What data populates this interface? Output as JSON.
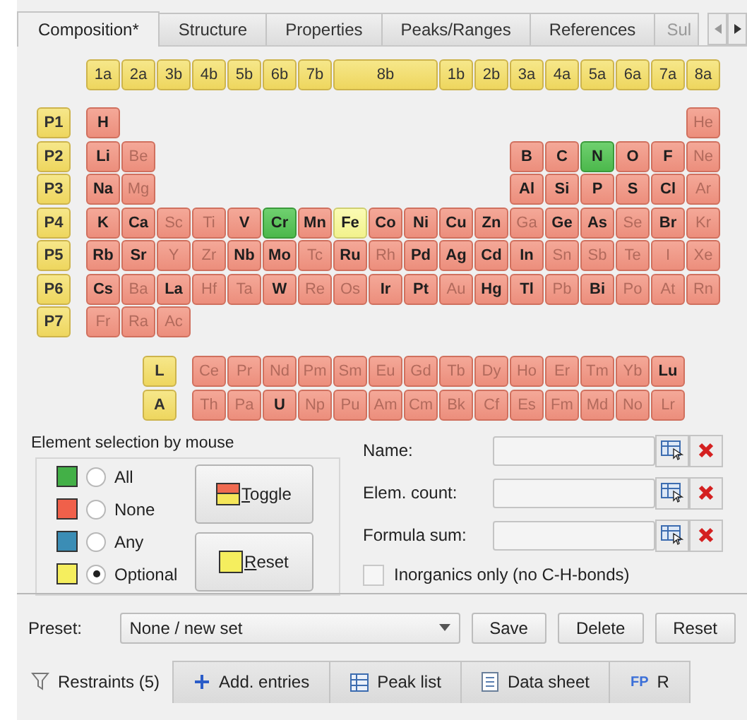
{
  "tabs": [
    {
      "label": "Composition*",
      "selected": true
    },
    {
      "label": "Structure",
      "selected": false
    },
    {
      "label": "Properties",
      "selected": false
    },
    {
      "label": "Peaks/Ranges",
      "selected": false
    },
    {
      "label": "References",
      "selected": false
    },
    {
      "label": "Sul",
      "selected": false
    }
  ],
  "groups": [
    {
      "label": "1a",
      "wide": false
    },
    {
      "label": "2a",
      "wide": false
    },
    {
      "label": "3b",
      "wide": false
    },
    {
      "label": "4b",
      "wide": false
    },
    {
      "label": "5b",
      "wide": false
    },
    {
      "label": "6b",
      "wide": false
    },
    {
      "label": "7b",
      "wide": false
    },
    {
      "label": "8b",
      "wide": true
    },
    {
      "label": "1b",
      "wide": false
    },
    {
      "label": "2b",
      "wide": false
    },
    {
      "label": "3a",
      "wide": false
    },
    {
      "label": "4a",
      "wide": false
    },
    {
      "label": "5a",
      "wide": false
    },
    {
      "label": "6a",
      "wide": false
    },
    {
      "label": "7a",
      "wide": false
    },
    {
      "label": "8a",
      "wide": false
    }
  ],
  "periods": [
    {
      "label": "P1",
      "left": [
        {
          "symbol": "H",
          "kind": "none",
          "dim": false
        }
      ],
      "right": [
        {
          "symbol": "He",
          "kind": "none",
          "dim": true
        }
      ]
    },
    {
      "label": "P2",
      "left": [
        {
          "symbol": "Li",
          "kind": "none",
          "dim": false
        },
        {
          "symbol": "Be",
          "kind": "none",
          "dim": true
        }
      ],
      "right": [
        {
          "symbol": "B",
          "kind": "none",
          "dim": false
        },
        {
          "symbol": "C",
          "kind": "none",
          "dim": false
        },
        {
          "symbol": "N",
          "kind": "all",
          "dim": false
        },
        {
          "symbol": "O",
          "kind": "none",
          "dim": false
        },
        {
          "symbol": "F",
          "kind": "none",
          "dim": false
        },
        {
          "symbol": "Ne",
          "kind": "none",
          "dim": true
        }
      ]
    },
    {
      "label": "P3",
      "left": [
        {
          "symbol": "Na",
          "kind": "none",
          "dim": false
        },
        {
          "symbol": "Mg",
          "kind": "none",
          "dim": true
        }
      ],
      "right": [
        {
          "symbol": "Al",
          "kind": "none",
          "dim": false
        },
        {
          "symbol": "Si",
          "kind": "none",
          "dim": false
        },
        {
          "symbol": "P",
          "kind": "none",
          "dim": false
        },
        {
          "symbol": "S",
          "kind": "none",
          "dim": false
        },
        {
          "symbol": "Cl",
          "kind": "none",
          "dim": false
        },
        {
          "symbol": "Ar",
          "kind": "none",
          "dim": true
        }
      ]
    },
    {
      "label": "P4",
      "left": [
        {
          "symbol": "K",
          "kind": "none",
          "dim": false
        },
        {
          "symbol": "Ca",
          "kind": "none",
          "dim": false
        },
        {
          "symbol": "Sc",
          "kind": "none",
          "dim": true
        },
        {
          "symbol": "Ti",
          "kind": "none",
          "dim": true
        },
        {
          "symbol": "V",
          "kind": "none",
          "dim": false
        },
        {
          "symbol": "Cr",
          "kind": "all",
          "dim": false
        },
        {
          "symbol": "Mn",
          "kind": "none",
          "dim": false
        },
        {
          "symbol": "Fe",
          "kind": "optional",
          "dim": false
        },
        {
          "symbol": "Co",
          "kind": "none",
          "dim": false
        },
        {
          "symbol": "Ni",
          "kind": "none",
          "dim": false
        },
        {
          "symbol": "Cu",
          "kind": "none",
          "dim": false
        },
        {
          "symbol": "Zn",
          "kind": "none",
          "dim": false
        },
        {
          "symbol": "Ga",
          "kind": "none",
          "dim": true
        },
        {
          "symbol": "Ge",
          "kind": "none",
          "dim": false
        },
        {
          "symbol": "As",
          "kind": "none",
          "dim": false
        },
        {
          "symbol": "Se",
          "kind": "none",
          "dim": true
        },
        {
          "symbol": "Br",
          "kind": "none",
          "dim": false
        },
        {
          "symbol": "Kr",
          "kind": "none",
          "dim": true
        }
      ]
    },
    {
      "label": "P5",
      "left": [
        {
          "symbol": "Rb",
          "kind": "none",
          "dim": false
        },
        {
          "symbol": "Sr",
          "kind": "none",
          "dim": false
        },
        {
          "symbol": "Y",
          "kind": "none",
          "dim": true
        },
        {
          "symbol": "Zr",
          "kind": "none",
          "dim": true
        },
        {
          "symbol": "Nb",
          "kind": "none",
          "dim": false
        },
        {
          "symbol": "Mo",
          "kind": "none",
          "dim": false
        },
        {
          "symbol": "Tc",
          "kind": "none",
          "dim": true
        },
        {
          "symbol": "Ru",
          "kind": "none",
          "dim": false
        },
        {
          "symbol": "Rh",
          "kind": "none",
          "dim": true
        },
        {
          "symbol": "Pd",
          "kind": "none",
          "dim": false
        },
        {
          "symbol": "Ag",
          "kind": "none",
          "dim": false
        },
        {
          "symbol": "Cd",
          "kind": "none",
          "dim": false
        },
        {
          "symbol": "In",
          "kind": "none",
          "dim": false
        },
        {
          "symbol": "Sn",
          "kind": "none",
          "dim": true
        },
        {
          "symbol": "Sb",
          "kind": "none",
          "dim": true
        },
        {
          "symbol": "Te",
          "kind": "none",
          "dim": true
        },
        {
          "symbol": "I",
          "kind": "none",
          "dim": true
        },
        {
          "symbol": "Xe",
          "kind": "none",
          "dim": true
        }
      ]
    },
    {
      "label": "P6",
      "left": [
        {
          "symbol": "Cs",
          "kind": "none",
          "dim": false
        },
        {
          "symbol": "Ba",
          "kind": "none",
          "dim": true
        },
        {
          "symbol": "La",
          "kind": "none",
          "dim": false
        },
        {
          "symbol": "Hf",
          "kind": "none",
          "dim": true
        },
        {
          "symbol": "Ta",
          "kind": "none",
          "dim": true
        },
        {
          "symbol": "W",
          "kind": "none",
          "dim": false
        },
        {
          "symbol": "Re",
          "kind": "none",
          "dim": true
        },
        {
          "symbol": "Os",
          "kind": "none",
          "dim": true
        },
        {
          "symbol": "Ir",
          "kind": "none",
          "dim": false
        },
        {
          "symbol": "Pt",
          "kind": "none",
          "dim": false
        },
        {
          "symbol": "Au",
          "kind": "none",
          "dim": true
        },
        {
          "symbol": "Hg",
          "kind": "none",
          "dim": false
        },
        {
          "symbol": "Tl",
          "kind": "none",
          "dim": false
        },
        {
          "symbol": "Pb",
          "kind": "none",
          "dim": true
        },
        {
          "symbol": "Bi",
          "kind": "none",
          "dim": false
        },
        {
          "symbol": "Po",
          "kind": "none",
          "dim": true
        },
        {
          "symbol": "At",
          "kind": "none",
          "dim": true
        },
        {
          "symbol": "Rn",
          "kind": "none",
          "dim": true
        }
      ]
    },
    {
      "label": "P7",
      "left": [
        {
          "symbol": "Fr",
          "kind": "none",
          "dim": true
        },
        {
          "symbol": "Ra",
          "kind": "none",
          "dim": true
        },
        {
          "symbol": "Ac",
          "kind": "none",
          "dim": true
        }
      ]
    }
  ],
  "series": [
    {
      "label": "L",
      "cells": [
        {
          "symbol": "Ce",
          "kind": "none",
          "dim": true
        },
        {
          "symbol": "Pr",
          "kind": "none",
          "dim": true
        },
        {
          "symbol": "Nd",
          "kind": "none",
          "dim": true
        },
        {
          "symbol": "Pm",
          "kind": "none",
          "dim": true
        },
        {
          "symbol": "Sm",
          "kind": "none",
          "dim": true
        },
        {
          "symbol": "Eu",
          "kind": "none",
          "dim": true
        },
        {
          "symbol": "Gd",
          "kind": "none",
          "dim": true
        },
        {
          "symbol": "Tb",
          "kind": "none",
          "dim": true
        },
        {
          "symbol": "Dy",
          "kind": "none",
          "dim": true
        },
        {
          "symbol": "Ho",
          "kind": "none",
          "dim": true
        },
        {
          "symbol": "Er",
          "kind": "none",
          "dim": true
        },
        {
          "symbol": "Tm",
          "kind": "none",
          "dim": true
        },
        {
          "symbol": "Yb",
          "kind": "none",
          "dim": true
        },
        {
          "symbol": "Lu",
          "kind": "none",
          "dim": false
        }
      ]
    },
    {
      "label": "A",
      "cells": [
        {
          "symbol": "Th",
          "kind": "none",
          "dim": true
        },
        {
          "symbol": "Pa",
          "kind": "none",
          "dim": true
        },
        {
          "symbol": "U",
          "kind": "none",
          "dim": false
        },
        {
          "symbol": "Np",
          "kind": "none",
          "dim": true
        },
        {
          "symbol": "Pu",
          "kind": "none",
          "dim": true
        },
        {
          "symbol": "Am",
          "kind": "none",
          "dim": true
        },
        {
          "symbol": "Cm",
          "kind": "none",
          "dim": true
        },
        {
          "symbol": "Bk",
          "kind": "none",
          "dim": true
        },
        {
          "symbol": "Cf",
          "kind": "none",
          "dim": true
        },
        {
          "symbol": "Es",
          "kind": "none",
          "dim": true
        },
        {
          "symbol": "Fm",
          "kind": "none",
          "dim": true
        },
        {
          "symbol": "Md",
          "kind": "none",
          "dim": true
        },
        {
          "symbol": "No",
          "kind": "none",
          "dim": true
        },
        {
          "symbol": "Lr",
          "kind": "none",
          "dim": true
        }
      ]
    }
  ],
  "selection": {
    "title": "Element selection by mouse",
    "modes": [
      {
        "label": "All",
        "color": "#43b047",
        "selected": false
      },
      {
        "label": "None",
        "color": "#f0604a",
        "selected": false
      },
      {
        "label": "Any",
        "color": "#3b8db5",
        "selected": false
      },
      {
        "label": "Optional",
        "color": "#f5ee5e",
        "selected": true
      }
    ],
    "buttons": [
      {
        "label": "Toggle",
        "kind": "toggle"
      },
      {
        "label": "Reset",
        "kind": "reset"
      }
    ]
  },
  "fields": [
    {
      "label": "Name:"
    },
    {
      "label": "Elem. count:"
    },
    {
      "label": "Formula sum:"
    }
  ],
  "inorganics": {
    "label": "Inorganics only (no C-H-bonds)",
    "checked": false
  },
  "preset": {
    "label": "Preset:",
    "value": "None / new set",
    "buttons": [
      "Save",
      "Delete",
      "Reset"
    ]
  },
  "bottom_tabs": [
    {
      "label": "Restraints (5)",
      "kind": "filter",
      "selected": true
    },
    {
      "label": "Add. entries",
      "kind": "plus",
      "selected": false
    },
    {
      "label": "Peak list",
      "kind": "table",
      "selected": false
    },
    {
      "label": "Data sheet",
      "kind": "document",
      "selected": false
    },
    {
      "label": "R",
      "kind": "fp",
      "badge": "FP",
      "selected": false
    }
  ]
}
